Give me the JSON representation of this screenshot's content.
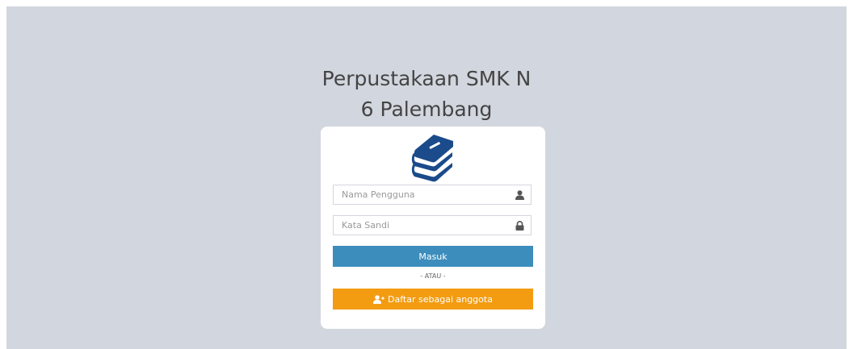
{
  "header": {
    "title_line1": "Perpustakaan SMK N",
    "title_line2": "6 Palembang"
  },
  "login": {
    "logo_icon": "book-stack-icon",
    "username": {
      "placeholder": "Nama Pengguna",
      "value": "",
      "icon": "user-icon"
    },
    "password": {
      "placeholder": "Kata Sandi",
      "value": "",
      "icon": "lock-icon"
    },
    "submit_label": "Masuk",
    "separator": "- ATAU -",
    "register_label": "Daftar sebagai anggota",
    "register_icon": "user-plus-icon"
  },
  "colors": {
    "background": "#d2d6de",
    "primary": "#3c8dbc",
    "warning": "#f39c12",
    "logo": "#1b4b8a"
  }
}
